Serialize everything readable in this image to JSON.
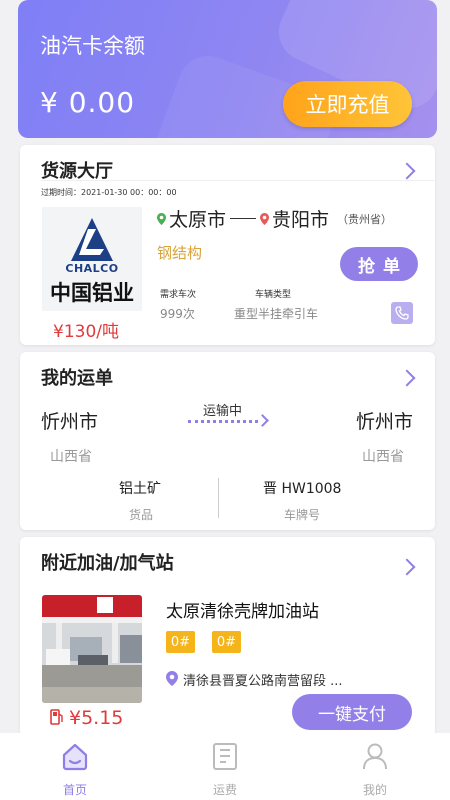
{
  "balance": {
    "title": "油汽卡余额",
    "amount": "¥ 0.00",
    "recharge_label": "立即充值"
  },
  "cargo": {
    "title": "货源大厅",
    "expire": "过期时间：2021-01-30 00：00：00",
    "logo_en": "CHALCO",
    "logo_cn": "中国铝业",
    "price": "¥130/吨",
    "from_city": "太原市",
    "to_city": "贵阳市",
    "to_province": "（贵州省）",
    "cargo_type": "钢结构",
    "grab_label": "抢单",
    "need_label": "需求车次",
    "need_value": "999次",
    "vehicle_label": "车辆类型",
    "vehicle_value": "重型半挂牵引车"
  },
  "waybill": {
    "title": "我的运单",
    "status": "运输中",
    "from_city": "忻州市",
    "from_province": "山西省",
    "to_city": "忻州市",
    "to_province": "山西省",
    "goods": "铝土矿",
    "goods_label": "货品",
    "plate": "晋 HW1008",
    "plate_label": "车牌号"
  },
  "station": {
    "title": "附近加油/加气站",
    "name": "太原清徐壳牌加油站",
    "fuel_types": [
      "0#",
      "0#"
    ],
    "address": "清徐县晋夏公路南营留段 ...",
    "price": "¥5.15",
    "pay_label": "一键支付"
  },
  "tabs": [
    {
      "label": "首页",
      "icon": "home-icon",
      "active": true
    },
    {
      "label": "运费",
      "icon": "bill-icon",
      "active": false
    },
    {
      "label": "我的",
      "icon": "user-icon",
      "active": false
    }
  ],
  "colors": {
    "accent": "#8e7fe6",
    "orange": "#ffa31a",
    "price_red": "#e03a3a",
    "fuel_badge": "#f4b41a"
  }
}
